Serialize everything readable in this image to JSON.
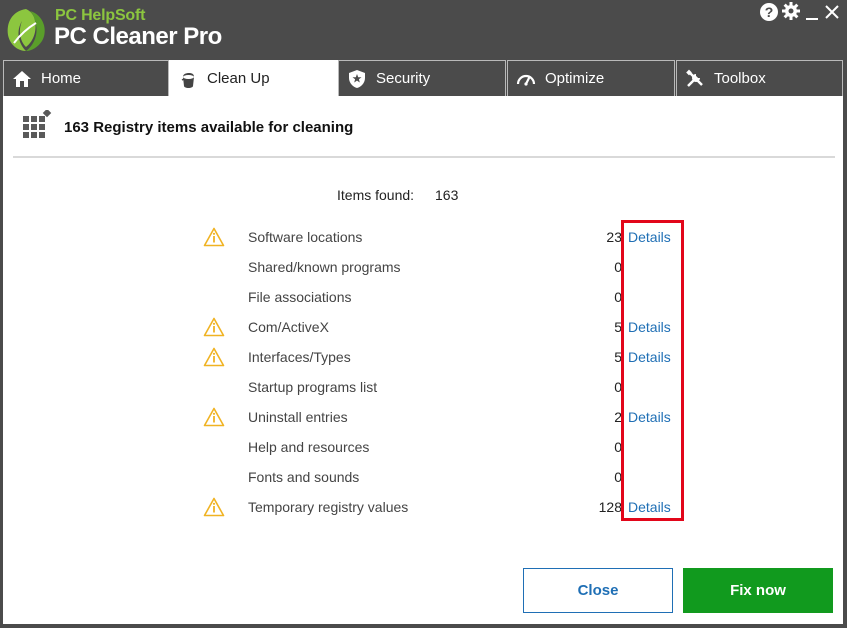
{
  "app": {
    "brand_small": "PC HelpSoft",
    "brand_large": "PC Cleaner Pro",
    "help_glyph": "?"
  },
  "tabs": [
    {
      "label": "Home",
      "icon": "home-icon",
      "active": false
    },
    {
      "label": "Clean Up",
      "icon": "broom-icon",
      "active": true
    },
    {
      "label": "Security",
      "icon": "shield-icon",
      "active": false
    },
    {
      "label": "Optimize",
      "icon": "speedometer-icon",
      "active": false
    },
    {
      "label": "Toolbox",
      "icon": "tools-icon",
      "active": false
    }
  ],
  "section": {
    "title": "163 Registry items available for cleaning",
    "icon": "grid-icon"
  },
  "summary": {
    "found_label": "Items found:",
    "found_value": "163"
  },
  "items": [
    {
      "label": "Software locations",
      "count": "23",
      "warning": true,
      "details": "Details"
    },
    {
      "label": "Shared/known programs",
      "count": "0",
      "warning": false,
      "details": ""
    },
    {
      "label": "File associations",
      "count": "0",
      "warning": false,
      "details": ""
    },
    {
      "label": "Com/ActiveX",
      "count": "5",
      "warning": true,
      "details": "Details"
    },
    {
      "label": "Interfaces/Types",
      "count": "5",
      "warning": true,
      "details": "Details"
    },
    {
      "label": "Startup programs list",
      "count": "0",
      "warning": false,
      "details": ""
    },
    {
      "label": "Uninstall entries",
      "count": "2",
      "warning": true,
      "details": "Details"
    },
    {
      "label": "Help and resources",
      "count": "0",
      "warning": false,
      "details": ""
    },
    {
      "label": "Fonts and sounds",
      "count": "0",
      "warning": false,
      "details": ""
    },
    {
      "label": "Temporary registry values",
      "count": "128",
      "warning": true,
      "details": "Details"
    }
  ],
  "buttons": {
    "close_label": "Close",
    "fix_label": "Fix now"
  },
  "colors": {
    "accent_green": "#119a1e",
    "link_blue": "#1f6fb5",
    "warning": "#f0b323",
    "highlight_red": "#e2061a",
    "chrome": "#4b4b4b"
  }
}
